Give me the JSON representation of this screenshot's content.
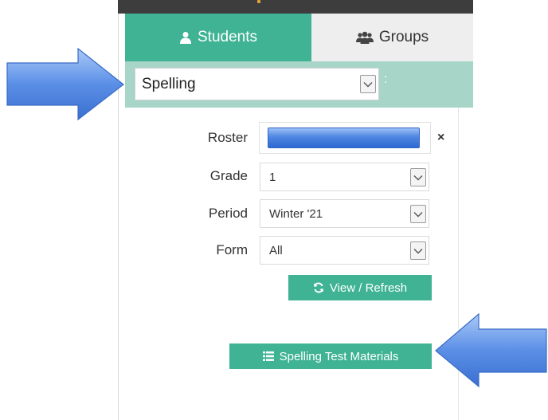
{
  "tabs": {
    "students": {
      "label": "Students",
      "icon": "user-icon"
    },
    "groups": {
      "label": "Groups",
      "icon": "users-icon"
    }
  },
  "assessment_select": {
    "value": "Spelling",
    "suffix": ":"
  },
  "filters": {
    "roster": {
      "label": "Roster",
      "clear": "×"
    },
    "grade": {
      "label": "Grade",
      "value": "1"
    },
    "period": {
      "label": "Period",
      "value": "Winter '21"
    },
    "form": {
      "label": "Form",
      "value": "All"
    }
  },
  "buttons": {
    "view_refresh": {
      "label": "View / Refresh",
      "icon": "refresh-icon"
    },
    "test_materials": {
      "label": "Spelling Test Materials",
      "icon": "list-icon"
    }
  },
  "colors": {
    "accent": "#3fb394",
    "selector_bar": "#a7d6c8",
    "topbar": "#3d3d3d",
    "callout_arrow": "#4a86e8"
  }
}
